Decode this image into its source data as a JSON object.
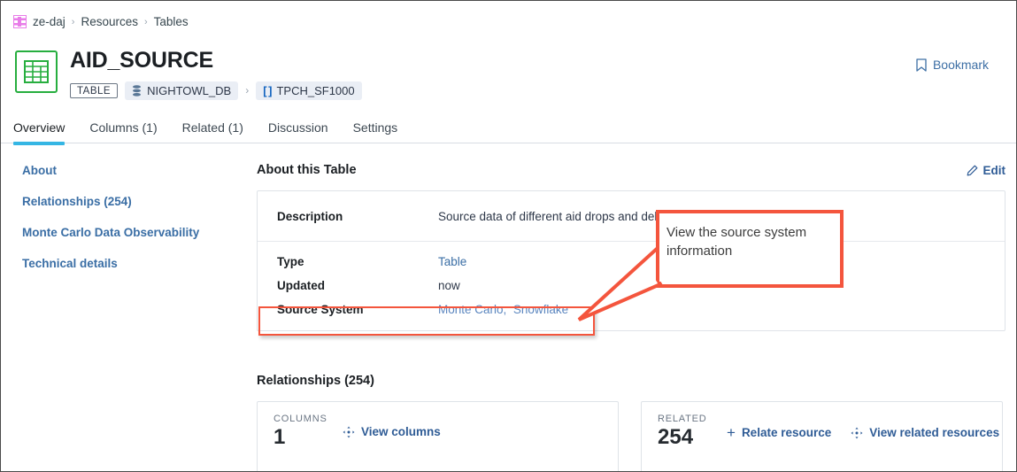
{
  "breadcrumb": {
    "logo_name": "ze-daj-logo",
    "items": [
      {
        "label": "ze-daj"
      },
      {
        "label": "Resources"
      },
      {
        "label": "Tables"
      }
    ],
    "separator": "›"
  },
  "header": {
    "title": "AID_SOURCE",
    "type_tag": "TABLE",
    "database": "NIGHTOWL_DB",
    "schema": "TPCH_SF1000",
    "schema_bracket": "[ ]",
    "chip_separator": "›",
    "bookmark_label": "Bookmark"
  },
  "tabs": [
    {
      "label": "Overview",
      "active": true
    },
    {
      "label": "Columns (1)",
      "active": false
    },
    {
      "label": "Related (1)",
      "active": false
    },
    {
      "label": "Discussion",
      "active": false
    },
    {
      "label": "Settings",
      "active": false
    }
  ],
  "sidebar": {
    "items": [
      {
        "label": "About"
      },
      {
        "label": "Relationships (254)"
      },
      {
        "label": "Monte Carlo Data Observability"
      },
      {
        "label": "Technical details"
      }
    ]
  },
  "about": {
    "section_title": "About this Table",
    "edit_label": "Edit",
    "rows": {
      "description_label": "Description",
      "description_value": "Source data of different aid drops and deliveries",
      "type_label": "Type",
      "type_value": "Table",
      "updated_label": "Updated",
      "updated_value": "now",
      "source_system_label": "Source System",
      "source_system_values": [
        "Monte Carlo",
        "Snowflake"
      ],
      "source_system_value_text": "Monte Carlo,  Snowflake"
    }
  },
  "relationships": {
    "section_title": "Relationships (254)",
    "cards": [
      {
        "caption": "COLUMNS",
        "count": "1",
        "actions": [
          {
            "label": "View columns",
            "icon": "lineage-icon"
          }
        ]
      },
      {
        "caption": "RELATED",
        "count": "254",
        "actions": [
          {
            "label": "Relate resource",
            "icon": "plus-icon"
          },
          {
            "label": "View related resources",
            "icon": "lineage-icon"
          }
        ]
      }
    ]
  },
  "annotation": {
    "text": "View the source system information",
    "color": "#f4553d"
  },
  "colors": {
    "accent_tab": "#35b6e4",
    "link": "#3a6ea5",
    "annotation": "#f4553d",
    "table_icon": "#27ae3f",
    "logo": "#e87ce8"
  }
}
